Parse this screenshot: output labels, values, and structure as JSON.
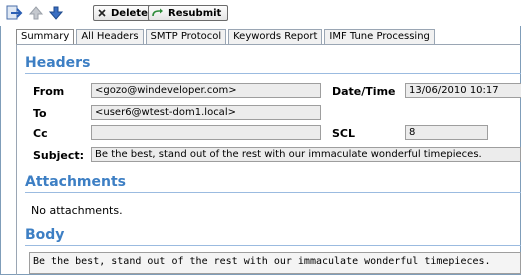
{
  "toolbar": {
    "delete_label": "Delete",
    "resubmit_label": "Resubmit"
  },
  "tabs": [
    {
      "label": "Summary",
      "active": true
    },
    {
      "label": "All Headers",
      "active": false
    },
    {
      "label": "SMTP Protocol",
      "active": false
    },
    {
      "label": "Keywords Report",
      "active": false
    },
    {
      "label": "IMF Tune Processing",
      "active": false
    }
  ],
  "headers": {
    "title": "Headers",
    "from_label": "From",
    "from_value": "<gozo@windeveloper.com>",
    "datetime_label": "Date/Time",
    "datetime_value": "13/06/2010 10:17",
    "to_label": "To",
    "to_value": "<user6@wtest-dom1.local>",
    "cc_label": "Cc",
    "cc_value": "",
    "scl_label": "SCL",
    "scl_value": "8",
    "subject_label": "Subject:",
    "subject_value": "Be the best, stand out of the rest with our immaculate wonderful timepieces."
  },
  "attachments": {
    "title": "Attachments",
    "empty_text": "No attachments."
  },
  "body": {
    "title": "Body",
    "text": "Be the best, stand out of the rest with our immaculate wonderful timepieces."
  },
  "colors": {
    "heading": "#3d7fc4",
    "field_bg": "#ececec",
    "arrow_blue": "#2b5fb4"
  }
}
